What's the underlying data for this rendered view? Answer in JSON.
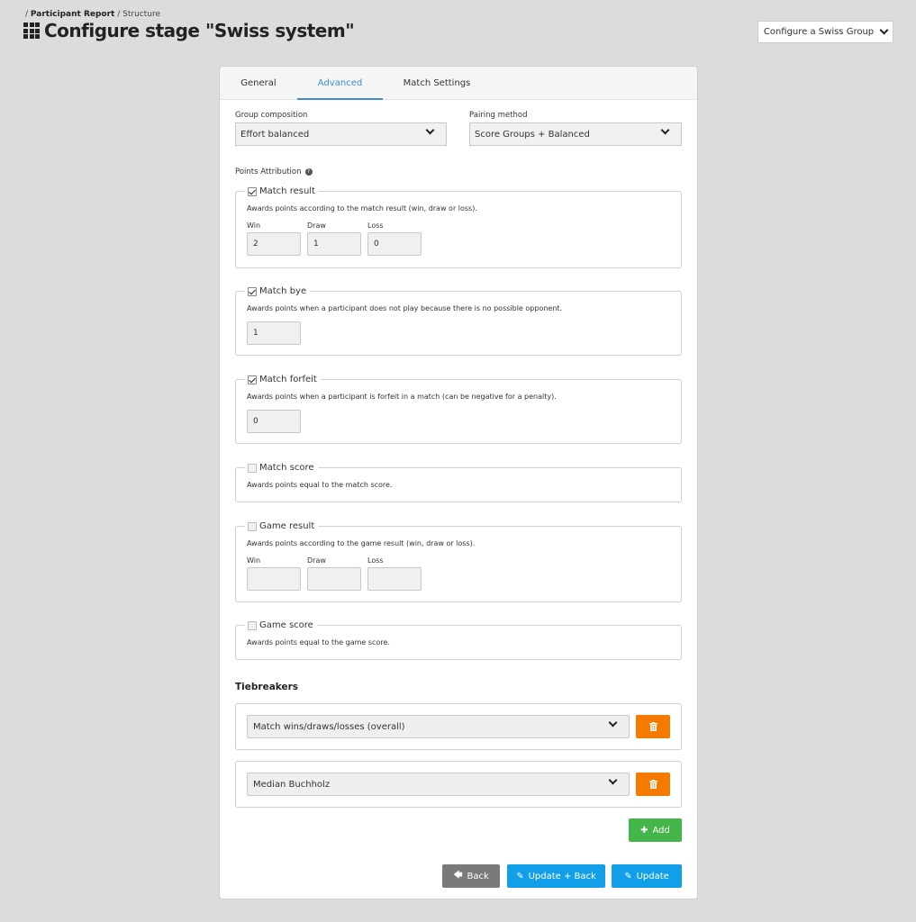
{
  "breadcrumb": {
    "sep1": "/",
    "link": "Participant Report",
    "sep2": "/",
    "current": "Structure"
  },
  "page": {
    "title": "Configure stage \"Swiss system\""
  },
  "header": {
    "group_button": "Configure a Swiss Group"
  },
  "tabs": [
    {
      "label": "General",
      "active": false
    },
    {
      "label": "Advanced",
      "active": true
    },
    {
      "label": "Match Settings",
      "active": false
    }
  ],
  "group_composition": {
    "label": "Group composition",
    "value": "Effort balanced"
  },
  "pairing_method": {
    "label": "Pairing method",
    "value": "Score Groups + Balanced"
  },
  "points_attribution": {
    "label": "Points Attribution",
    "match_result": {
      "legend": "Match result",
      "checked": true,
      "description": "Awards points according to the match result (win, draw or loss).",
      "win_label": "Win",
      "win": "2",
      "draw_label": "Draw",
      "draw": "1",
      "loss_label": "Loss",
      "loss": "0"
    },
    "match_bye": {
      "legend": "Match bye",
      "checked": true,
      "description": "Awards points when a participant does not play because there is no possible opponent.",
      "value": "1"
    },
    "match_forfeit": {
      "legend": "Match forfeit",
      "checked": true,
      "description": "Awards points when a participant is forfeit in a match (can be negative for a penalty).",
      "value": "0"
    },
    "match_score": {
      "legend": "Match score",
      "checked": false,
      "description": "Awards points equal to the match score."
    },
    "game_result": {
      "legend": "Game result",
      "checked": false,
      "description": "Awards points according to the game result (win, draw or loss).",
      "win_label": "Win",
      "win": "",
      "draw_label": "Draw",
      "draw": "",
      "loss_label": "Loss",
      "loss": ""
    },
    "game_score": {
      "legend": "Game score",
      "checked": false,
      "description": "Awards points equal to the game score."
    }
  },
  "tiebreakers": {
    "title": "Tiebreakers",
    "items": [
      {
        "value": "Match wins/draws/losses (overall)"
      },
      {
        "value": "Median Buchholz"
      }
    ],
    "add_label": "Add"
  },
  "footer": {
    "back_label": "Back",
    "update_back_label": "Update + Back",
    "update_label": "Update"
  },
  "colors": {
    "accent": "#129fea",
    "delete": "#f57a00",
    "add": "#44b549",
    "back": "#7a7a7a"
  },
  "icons": {
    "grid": "grid-icon",
    "chevron": "chevron-down-icon",
    "help": "question-circle-icon",
    "trash": "trash-icon",
    "plus": "plus-icon",
    "arrow_left": "arrow-left-icon",
    "pencil": "pencil-icon"
  }
}
